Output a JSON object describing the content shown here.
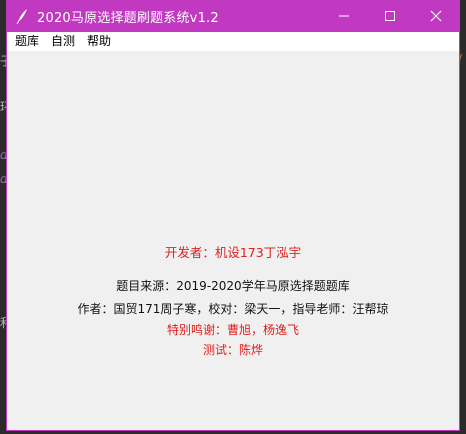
{
  "window": {
    "title": "2020马原选择题刷题系统v1.2",
    "titlebar_color": "#c039c0",
    "icon": "feather-icon",
    "controls": [
      "minimize-icon",
      "maximize-icon",
      "close-icon"
    ]
  },
  "menu": {
    "items": [
      "题库",
      "自测",
      "帮助"
    ]
  },
  "info": {
    "developer": "开发者：机设173丁泓宇",
    "source": "题目来源：2019-2020学年马原选择题题库",
    "author": "作者：国贸171周子寒，校对：梁天一，指导老师：汪帮琼",
    "thanks": "特别鸣谢：曹旭，杨逸飞",
    "tester": "测试：陈烨",
    "highlight_color": "#e02020"
  },
  "background_editor": {
    "glyphs": [
      "子",
      "环",
      "d",
      "d",
      "和",
      "/"
    ]
  }
}
